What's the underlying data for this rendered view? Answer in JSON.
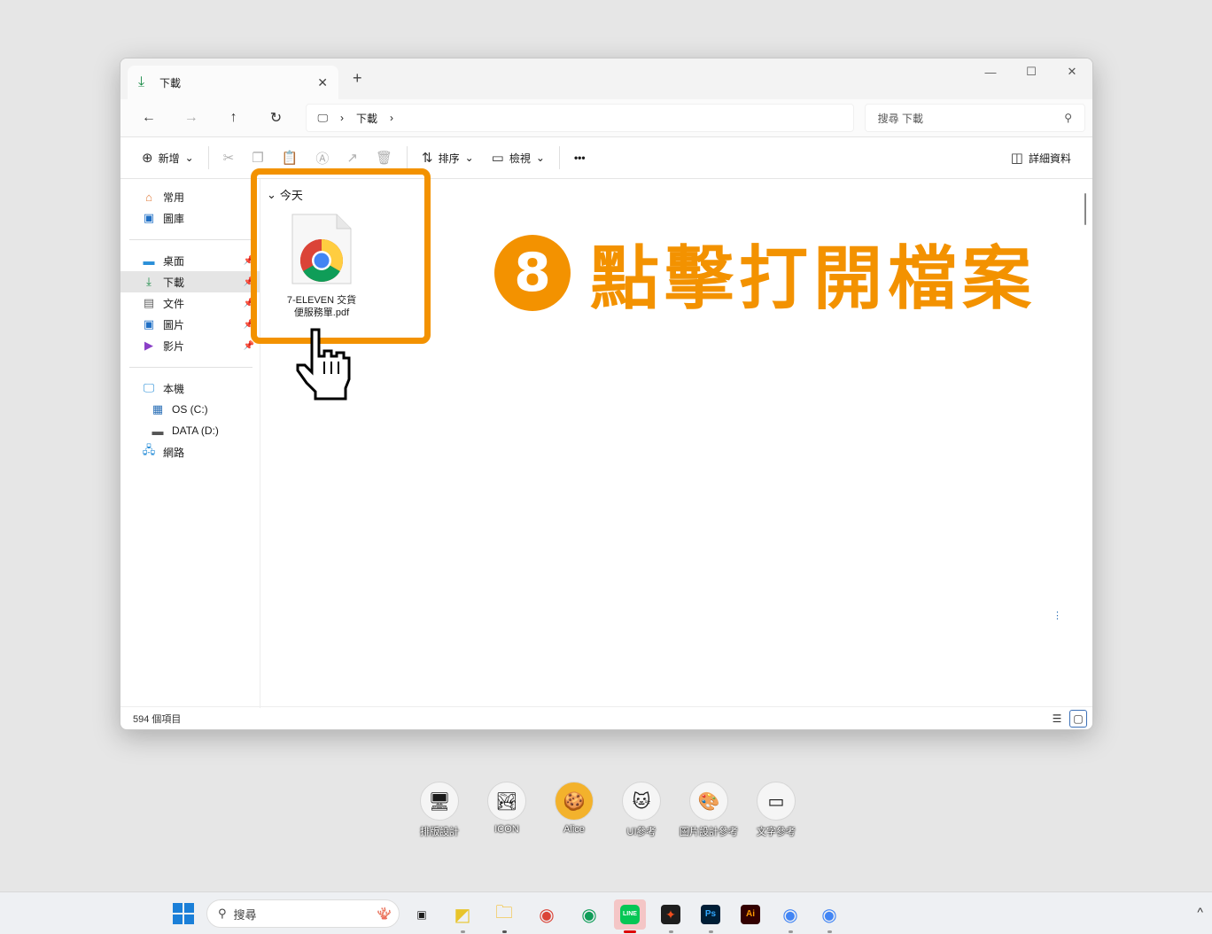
{
  "window": {
    "tab_title": "下載",
    "new_tab": "+",
    "path_segment": "下載",
    "search_placeholder": "搜尋 下載"
  },
  "toolbar": {
    "new_label": "新增",
    "sort_label": "排序",
    "view_label": "檢視",
    "more_label": "•••",
    "details_label": "詳細資料"
  },
  "sidebar": {
    "items": [
      {
        "label": "常用"
      },
      {
        "label": "圖庫"
      },
      {
        "label": "桌面"
      },
      {
        "label": "下載"
      },
      {
        "label": "文件"
      },
      {
        "label": "圖片"
      },
      {
        "label": "影片"
      },
      {
        "label": "本機"
      },
      {
        "label": "OS (C:)"
      },
      {
        "label": "DATA (D:)"
      },
      {
        "label": "網路"
      }
    ]
  },
  "content": {
    "group_header": "今天",
    "file_name_line1": "7-ELEVEN 交貨",
    "file_name_line2": "便服務單.pdf"
  },
  "status": {
    "item_count": "594 個項目"
  },
  "annotation": {
    "step_number": "8",
    "step_text": "點擊打開檔案",
    "color": "#f39200"
  },
  "desktop_icons": [
    {
      "label": "排版設計"
    },
    {
      "label": "ICON"
    },
    {
      "label": "Alice"
    },
    {
      "label": "UI參考"
    },
    {
      "label": "圖片設計參考"
    },
    {
      "label": "文字參考"
    }
  ],
  "taskbar": {
    "search_label": "搜尋"
  }
}
